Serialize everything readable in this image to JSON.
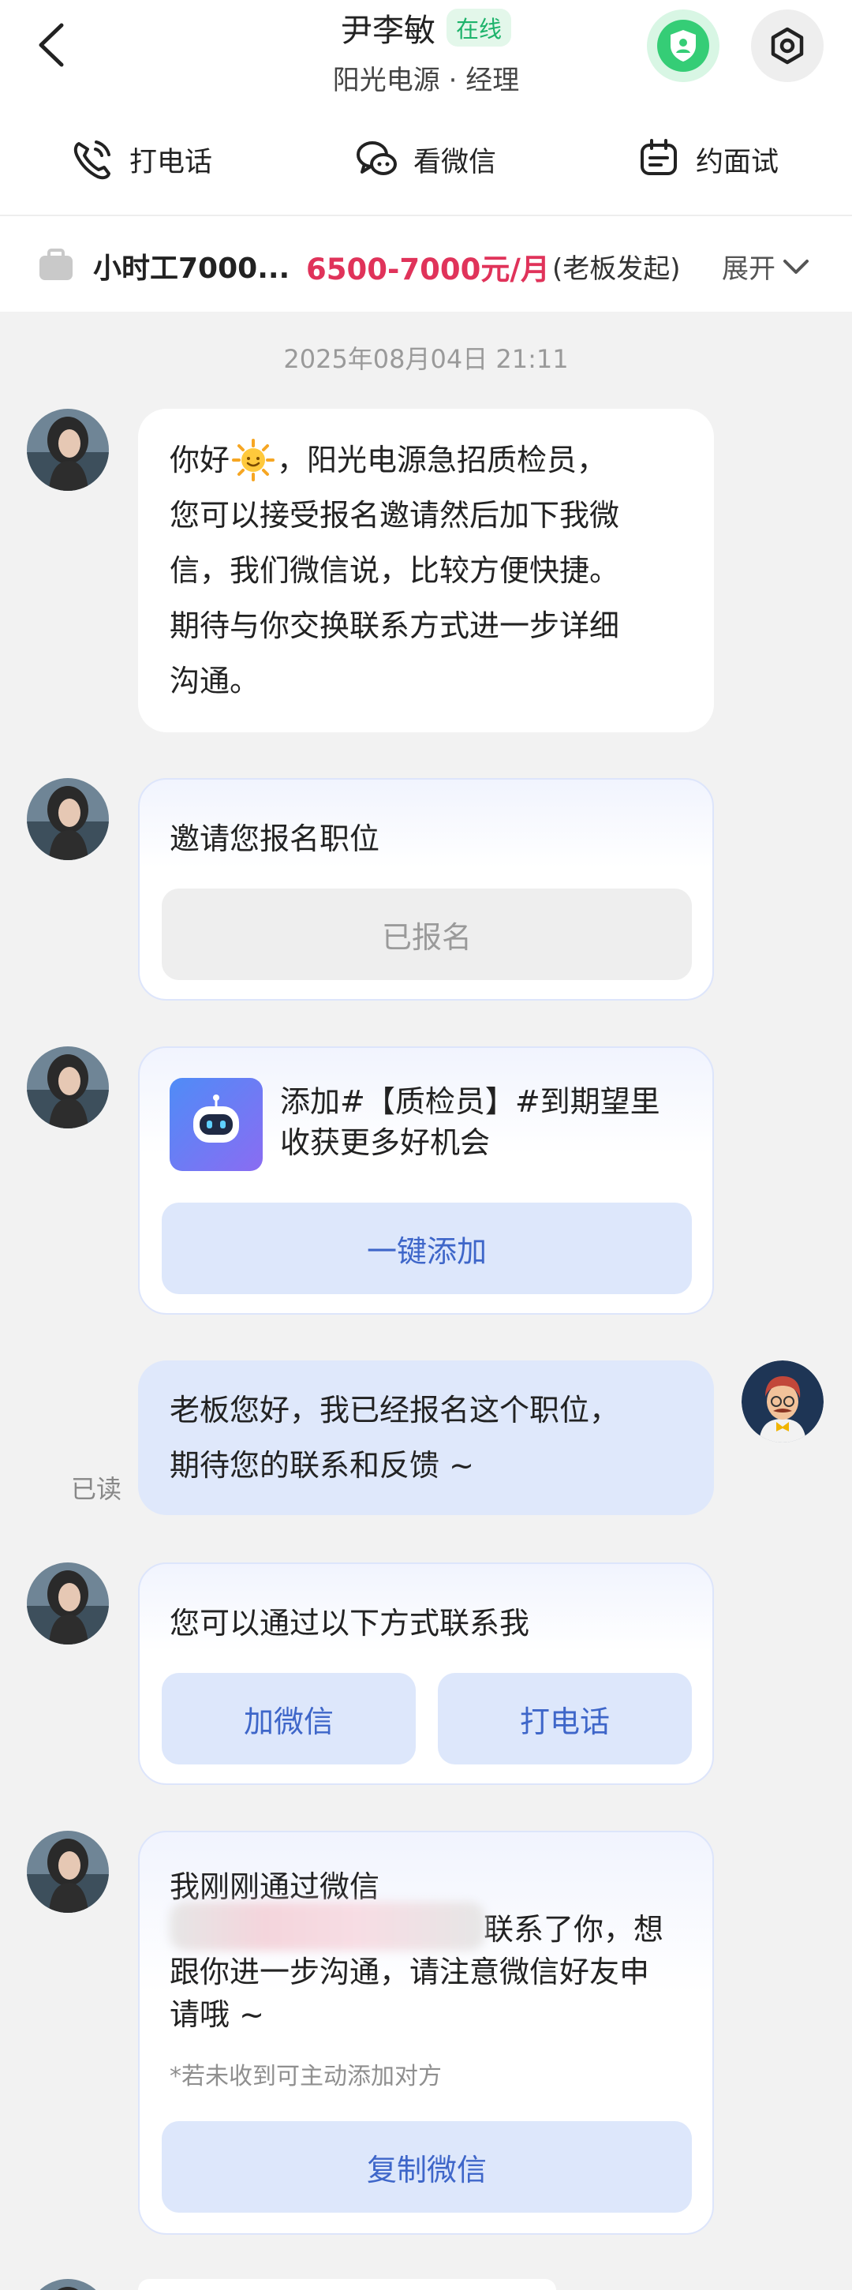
{
  "header": {
    "name": "尹李敏",
    "status": "在线",
    "subtitle": "阳光电源 · 经理"
  },
  "actions": {
    "call": "打电话",
    "wechat": "看微信",
    "interview": "约面试"
  },
  "job": {
    "title": "小时工7000...",
    "salary": "6500-7000元/月",
    "note": "(老板发起)",
    "expand": "展开"
  },
  "chat": {
    "timestamp": "2025年08月04日 21:11",
    "msg1": {
      "lines": [
        "你好",
        "，阳光电源急招质检员，",
        "您可以接受报名邀请然后加下我微",
        "信，我们微信说，比较方便快捷。",
        "期待与你交换联系方式进一步详细",
        "沟通。"
      ]
    },
    "msg2": {
      "title": "邀请您报名职位",
      "button": "已报名"
    },
    "msg3": {
      "text_line1": "添加#【质检员】#到期望里",
      "text_line2": "收获更多好机会",
      "button": "一键添加"
    },
    "msg4": {
      "line1": "老板您好，我已经报名这个职位，",
      "line2": "期待您的联系和反馈 ~",
      "read": "已读"
    },
    "msg5": {
      "title": "您可以通过以下方式联系我",
      "button_wechat": "加微信",
      "button_call": "打电话"
    },
    "msg6": {
      "line1": "我刚刚通过微信",
      "line2_end": "联系了你，想",
      "line3": "跟你进一步沟通，请注意微信好友申",
      "line4": "请哦 ~",
      "hint": "*若未收到可主动添加对方",
      "button": "复制微信"
    }
  },
  "colors": {
    "accent_blue": "#3e66c9",
    "salary_red": "#e0335a",
    "online_green": "#1db36b"
  }
}
